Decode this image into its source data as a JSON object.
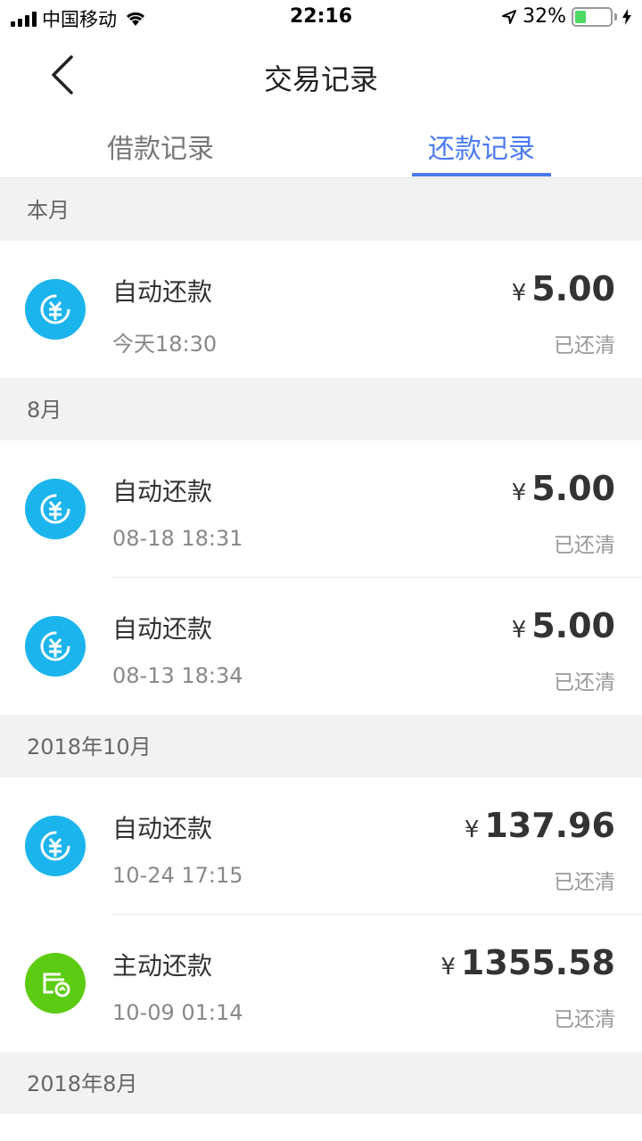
{
  "status_bar": {
    "carrier": "中国移动",
    "time": "22:16",
    "battery": "32%",
    "battery_level": 0.32
  },
  "nav": {
    "title": "交易记录"
  },
  "tabs": [
    {
      "label": "借款记录",
      "active": false
    },
    {
      "label": "还款记录",
      "active": true
    }
  ],
  "sections": [
    {
      "header": "本月",
      "records": [
        {
          "title": "自动还款",
          "date": "今天18:30",
          "currency": "¥",
          "amount": "5.00",
          "status": "已还清",
          "icon": "yuan-refresh-icon"
        }
      ]
    },
    {
      "header": "8月",
      "records": [
        {
          "title": "自动还款",
          "date": "08-18 18:31",
          "currency": "¥",
          "amount": "5.00",
          "status": "已还清",
          "icon": "yuan-refresh-icon"
        },
        {
          "title": "自动还款",
          "date": "08-13 18:34",
          "currency": "¥",
          "amount": "5.00",
          "status": "已还清",
          "icon": "yuan-refresh-icon"
        }
      ]
    },
    {
      "header": "2018年10月",
      "records": [
        {
          "title": "自动还款",
          "date": "10-24 17:15",
          "currency": "¥",
          "amount": "137.96",
          "status": "已还清",
          "icon": "yuan-refresh-icon"
        },
        {
          "title": "主动还款",
          "date": "10-09 01:14",
          "currency": "¥",
          "amount": "1355.58",
          "status": "已还清",
          "icon": "card-upload-icon"
        }
      ]
    },
    {
      "header": "2018年8月",
      "records": []
    }
  ],
  "colors": {
    "accent": "#4a7bf0",
    "icon_blue": "#1cb4ec",
    "icon_green": "#5ccc12"
  }
}
